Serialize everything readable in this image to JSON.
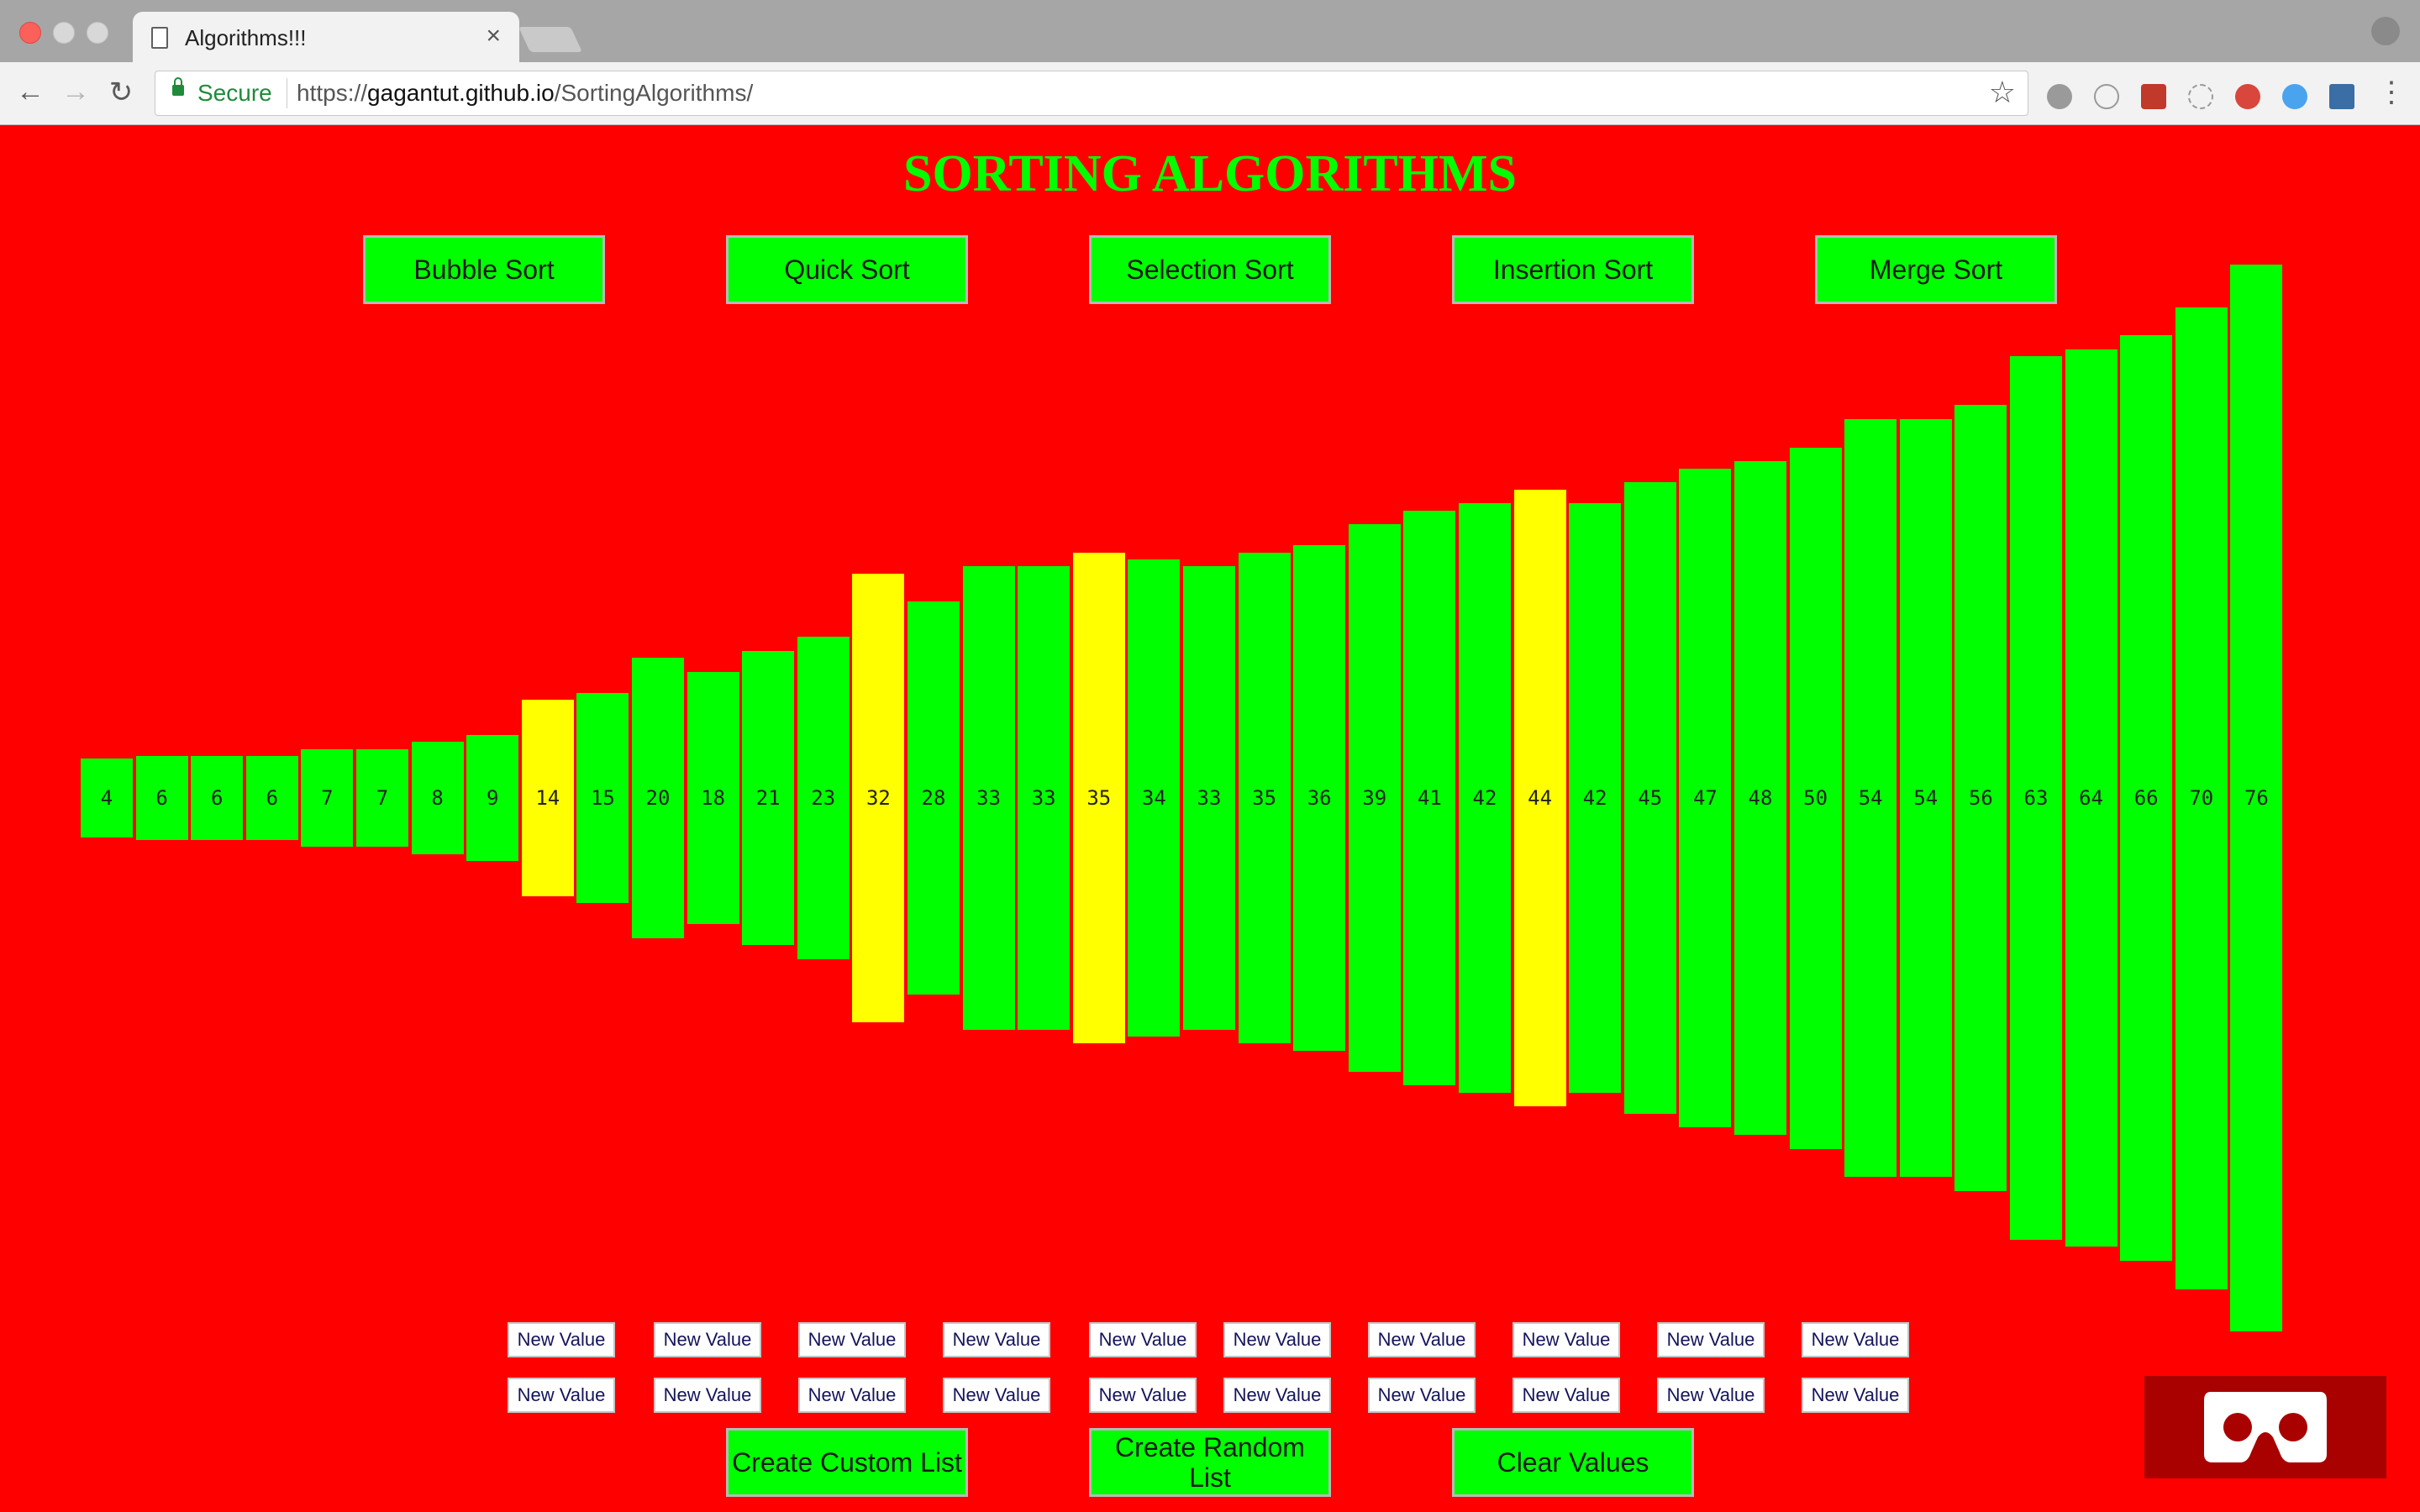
{
  "browser": {
    "tab_title": "Algorithms!!!",
    "tab_close": "×",
    "secure_label": "Secure",
    "url_scheme": "https://",
    "url_host": "gagantut.github.io",
    "url_path": "/SortingAlgorithms/",
    "back": "←",
    "forward": "→",
    "reload": "↻",
    "star": "☆"
  },
  "page": {
    "title": "SORTING ALGORITHMS",
    "algorithm_buttons": [
      "Bubble Sort",
      "Quick Sort",
      "Selection Sort",
      "Insertion Sort",
      "Merge Sort"
    ],
    "input_placeholder": "New Value",
    "input_rows": 2,
    "inputs_per_row": 10,
    "action_buttons": [
      "Create Custom List",
      "Create Random List",
      "Clear Values"
    ]
  },
  "colors": {
    "background": "#ff0000",
    "bar": "#00ff00",
    "highlight": "#ffff00",
    "title": "#00ff00",
    "vr": "#a90000"
  },
  "chart_data": {
    "type": "bar",
    "values": [
      4,
      6,
      6,
      6,
      7,
      7,
      8,
      9,
      14,
      15,
      20,
      18,
      21,
      23,
      32,
      28,
      33,
      33,
      35,
      34,
      33,
      35,
      36,
      39,
      41,
      42,
      44,
      42,
      45,
      47,
      48,
      50,
      54,
      54,
      56,
      63,
      64,
      66,
      70,
      76
    ],
    "highlighted": [
      8,
      14,
      18,
      26
    ]
  }
}
